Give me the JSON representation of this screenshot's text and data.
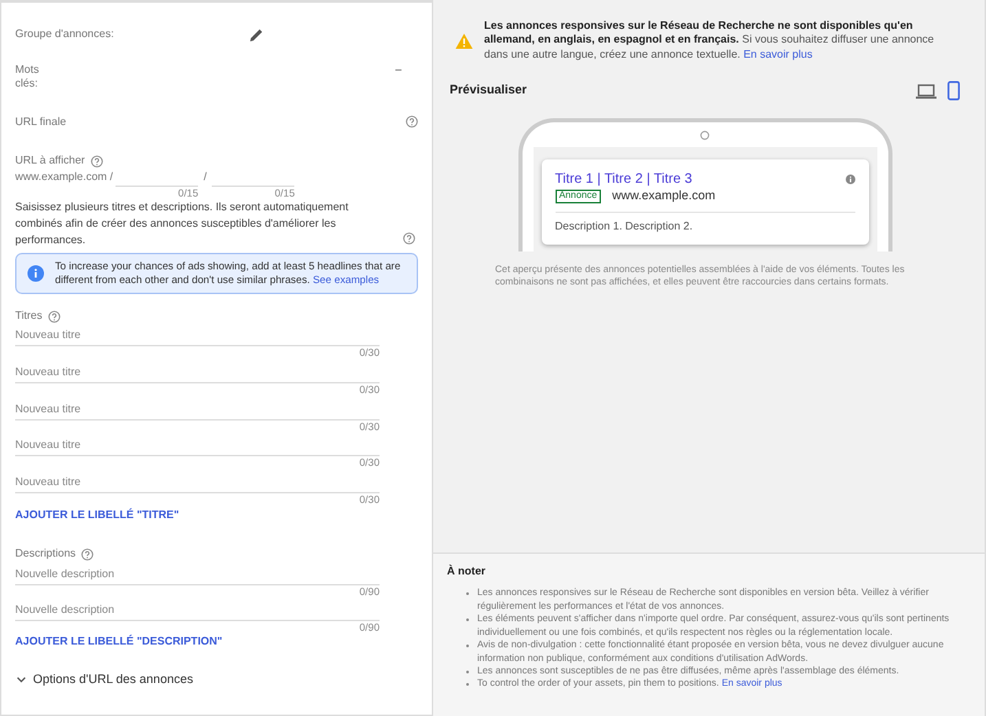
{
  "ad_group": {
    "label": "Groupe d'annonces:"
  },
  "keywords": {
    "label": "Mots clés:",
    "value": "–"
  },
  "final_url": {
    "label": "URL finale"
  },
  "display_url": {
    "label": "URL à afficher",
    "base": "www.example.com /",
    "separator": "/",
    "paths": [
      {
        "counter": "0/15"
      },
      {
        "counter": "0/15"
      }
    ]
  },
  "intro": "Saisissez plusieurs titres et descriptions. Ils seront automatiquement combinés afin de créer des annonces susceptibles d'améliorer les performances.",
  "tip": {
    "text": "To increase your chances of ads showing, add at least 5 headlines that are different from each other and don't use similar phrases.",
    "link": "See examples"
  },
  "headlines": {
    "label": "Titres",
    "add_link": "AJOUTER LE LIBELLÉ \"TITRE\"",
    "fields": [
      {
        "placeholder": "Nouveau titre",
        "counter": "0/30"
      },
      {
        "placeholder": "Nouveau titre",
        "counter": "0/30"
      },
      {
        "placeholder": "Nouveau titre",
        "counter": "0/30"
      },
      {
        "placeholder": "Nouveau titre",
        "counter": "0/30"
      },
      {
        "placeholder": "Nouveau titre",
        "counter": "0/30"
      }
    ]
  },
  "descriptions": {
    "label": "Descriptions",
    "add_link": "AJOUTER LE LIBELLÉ \"DESCRIPTION\"",
    "fields": [
      {
        "placeholder": "Nouvelle description",
        "counter": "0/90"
      },
      {
        "placeholder": "Nouvelle description",
        "counter": "0/90"
      }
    ]
  },
  "url_options": {
    "label": "Options d'URL des annonces",
    "expanded": false
  },
  "notice": {
    "text": "**Les annonces responsives sur le Réseau de Recherche ne sont disponibles qu'en allemand, en anglais, en espagnol et en français.** Si vous souhaitez diffuser une annonce dans une autre langue, créez une annonce textuelle.",
    "link": "En savoir plus"
  },
  "preview": {
    "title": "Prévisualiser",
    "devices": [
      {
        "kind": "desktop",
        "selected": false
      },
      {
        "kind": "mobile",
        "selected": true
      }
    ],
    "ad": {
      "headline": "Titre 1 | Titre 2 | Titre 3",
      "badge": "Annonce",
      "url": "www.example.com",
      "description": "Description 1. Description 2."
    },
    "caption": "Cet aperçu présente des annonces potentielles assemblées à l'aide de vos éléments. Toutes les combinaisons ne sont pas affichées, et elles peuvent être raccourcies dans certains formats."
  },
  "notes": {
    "title": "À noter",
    "items": [
      {
        "text": "Les annonces responsives sur le Réseau de Recherche sont disponibles en version bêta. Veillez à vérifier régulièrement les performances et l'état de vos annonces."
      },
      {
        "text": "Les éléments peuvent s'afficher dans n'importe quel ordre. Par conséquent, assurez-vous qu'ils sont pertinents individuellement ou une fois combinés, et qu'ils respectent nos règles ou la réglementation locale."
      },
      {
        "text": "Avis de non-divulgation : cette fonctionnalité étant proposée en version bêta, vous ne devez divulguer aucune information non publique, conformément aux conditions d'utilisation AdWords."
      },
      {
        "text": "Les annonces sont susceptibles de ne pas être diffusées, même après l'assemblage des éléments."
      },
      {
        "text": "To control the order of your assets, pin them to positions.",
        "link": "En savoir plus"
      }
    ]
  }
}
